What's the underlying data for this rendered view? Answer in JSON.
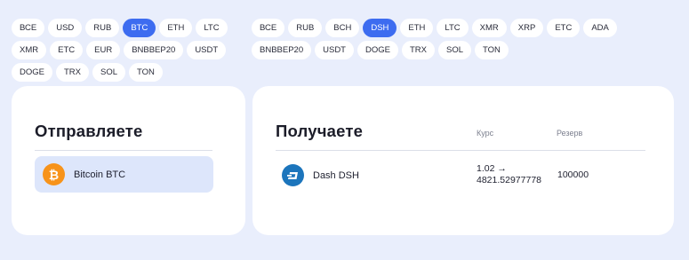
{
  "send_filters": [
    "ВСЕ",
    "USD",
    "RUB",
    "BTC",
    "ETH",
    "LTC",
    "XMR",
    "ETC",
    "EUR",
    "BNBBEP20",
    "USDT",
    "DOGE",
    "TRX",
    "SOL",
    "TON"
  ],
  "send_filter_active": "BTC",
  "receive_filters": [
    "ВСЕ",
    "RUB",
    "BCH",
    "DSH",
    "ETH",
    "LTC",
    "XMR",
    "XRP",
    "ETC",
    "ADA",
    "BNBBEP20",
    "USDT",
    "DOGE",
    "TRX",
    "SOL",
    "TON"
  ],
  "receive_filter_active": "DSH",
  "send_panel": {
    "title": "Отправляете",
    "selected": {
      "name": "Bitcoin BTC",
      "icon": "bitcoin-icon",
      "icon_color": "#f7931a"
    }
  },
  "receive_panel": {
    "title": "Получаете",
    "col_rate": "Курс",
    "col_reserve": "Резерв",
    "row": {
      "name": "Dash DSH",
      "icon": "dash-icon",
      "icon_color": "#1c75bc",
      "rate_line1": "1.02 →",
      "rate_line2": "4821.52977778",
      "reserve": "100000"
    }
  },
  "colors": {
    "accent": "#3d6cf0",
    "background": "#e9eefc",
    "selected_bg": "#dde6fb"
  }
}
